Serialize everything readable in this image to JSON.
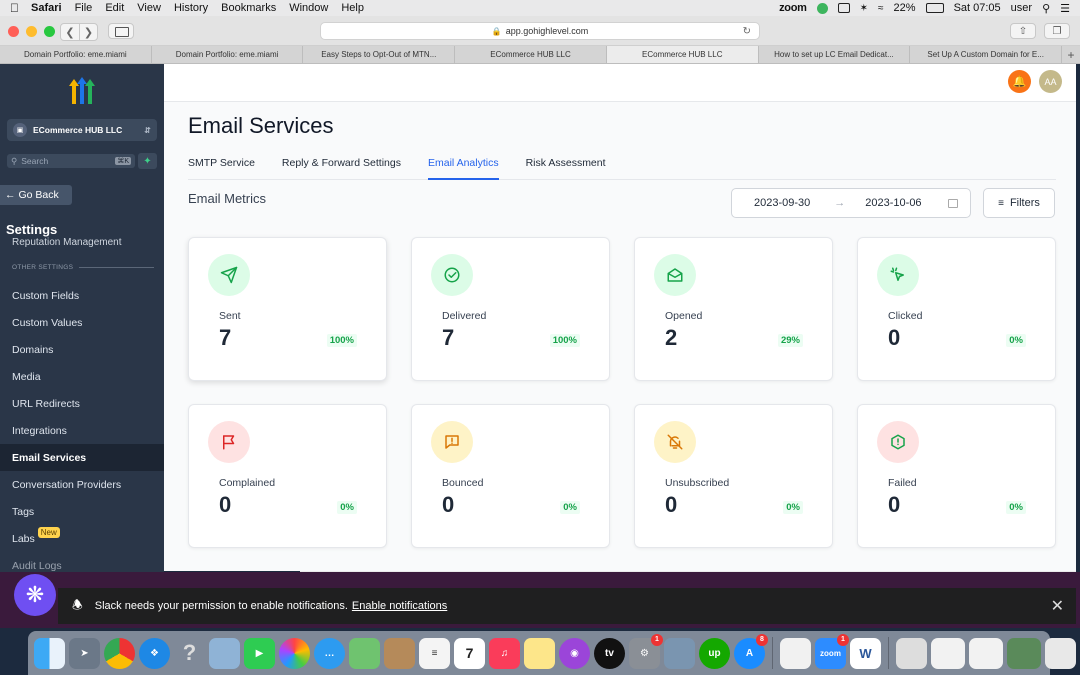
{
  "menubar": {
    "app": "Safari",
    "items": [
      "File",
      "Edit",
      "View",
      "History",
      "Bookmarks",
      "Window",
      "Help"
    ],
    "zoom": "zoom",
    "battery": "22%",
    "clock": "Sat 07:05",
    "user": "user"
  },
  "browser": {
    "url": "app.gohighlevel.com",
    "tabs": [
      "Domain Portfolio: eme.miami",
      "Domain Portfolio: eme.miami",
      "Easy Steps to Opt-Out of MTN...",
      "ECommerce HUB LLC",
      "ECommerce HUB LLC",
      "How to set up LC Email Dedicat...",
      "Set Up A Custom Domain for E..."
    ]
  },
  "sidebar": {
    "account": "ECommerce HUB LLC",
    "search_placeholder": "Search",
    "search_shortcut": "⌘K",
    "go_back": "Go Back",
    "heading": "Settings",
    "reputation": "Reputation Management",
    "section_label": "OTHER SETTINGS",
    "items": [
      "Custom Fields",
      "Custom Values",
      "Domains",
      "Media",
      "URL Redirects",
      "Integrations",
      "Email Services",
      "Conversation Providers",
      "Tags",
      "Labs",
      "Audit Logs"
    ],
    "labs_badge": "New"
  },
  "header": {
    "avatar": "AA"
  },
  "page": {
    "title": "Email Services",
    "tabs": [
      "SMTP Service",
      "Reply & Forward Settings",
      "Email Analytics",
      "Risk Assessment"
    ],
    "metrics_title": "Email Metrics",
    "date_start": "2023-09-30",
    "date_end": "2023-10-06",
    "filters": "Filters"
  },
  "metrics": [
    {
      "label": "Sent",
      "value": "7",
      "pct": "100%",
      "icon": "send-icon",
      "bg": "#dcfce7",
      "fg": "#16a34a"
    },
    {
      "label": "Delivered",
      "value": "7",
      "pct": "100%",
      "icon": "check-circle-icon",
      "bg": "#dcfce7",
      "fg": "#16a34a"
    },
    {
      "label": "Opened",
      "value": "2",
      "pct": "29%",
      "icon": "mail-open-icon",
      "bg": "#dcfce7",
      "fg": "#16a34a"
    },
    {
      "label": "Clicked",
      "value": "0",
      "pct": "0%",
      "icon": "cursor-click-icon",
      "bg": "#dcfce7",
      "fg": "#16a34a"
    },
    {
      "label": "Complained",
      "value": "0",
      "pct": "0%",
      "icon": "flag-icon",
      "bg": "#fee2e2",
      "fg": "#dc2626"
    },
    {
      "label": "Bounced",
      "value": "0",
      "pct": "0%",
      "icon": "alert-square-icon",
      "bg": "#fef3c7",
      "fg": "#d97706"
    },
    {
      "label": "Unsubscribed",
      "value": "0",
      "pct": "0%",
      "icon": "bell-off-icon",
      "bg": "#fef3c7",
      "fg": "#d97706"
    },
    {
      "label": "Failed",
      "value": "0",
      "pct": "0%",
      "icon": "alert-octagon-icon",
      "bg": "#fee2e2",
      "fg": "#16a34a"
    }
  ],
  "slack": {
    "message": "Slack needs your permission to enable notifications.",
    "link": "Enable notifications"
  },
  "dock": {
    "calendar_day": "7",
    "tv": "tv",
    "upwork": "up",
    "zoom": "zoom",
    "word": "W",
    "badge_settings": "1",
    "badge_appstore": "8",
    "badge_zoom": "1"
  }
}
